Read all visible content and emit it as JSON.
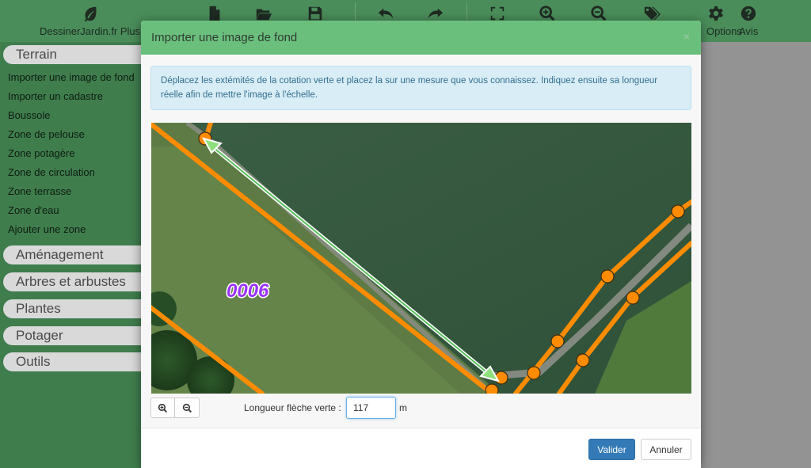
{
  "toolbar": {
    "brand_label": "DessinerJardin.fr Plus",
    "options_label": "Options",
    "avis_label": "Avis",
    "icons": [
      "leaf-icon",
      "new-file-icon",
      "folder-open-icon",
      "save-icon",
      "undo-icon",
      "redo-icon",
      "fullscreen-icon",
      "zoom-in-icon",
      "zoom-out-icon",
      "tags-icon",
      "gear-icon",
      "help-icon"
    ]
  },
  "sidebar": {
    "sections": [
      "Terrain",
      "Aménagement",
      "Arbres et arbustes",
      "Plantes",
      "Potager",
      "Outils"
    ],
    "terrain_items": [
      "Importer une image de fond",
      "Importer un cadastre",
      "Boussole",
      "Zone de pelouse",
      "Zone potagère",
      "Zone de circulation",
      "Zone terrasse",
      "Zone d'eau",
      "Ajouter une zone"
    ]
  },
  "modal": {
    "title": "Importer une image de fond",
    "close_glyph": "×",
    "info_text": "Déplacez les extémités de la cotation verte et placez la sur une mesure que vous connaissez. Indiquez ensuite sa longueur réelle afin de mettre l'image à l'échelle.",
    "map_label": "0006",
    "length_label": "Longueur flèche verte :",
    "length_value": "117",
    "length_unit": "m",
    "validate_label": "Valider",
    "cancel_label": "Annuler"
  },
  "colors": {
    "toolbar_bg": "#4a8d5a",
    "modal_header_bg": "#6bbf7c",
    "info_bg": "#d9edf7",
    "info_text": "#31708f",
    "primary_button": "#337ab7",
    "cadastre_line": "#ff8c00",
    "measure_arrow": "#7ee07a",
    "parcel_label": "#9b30ff"
  }
}
